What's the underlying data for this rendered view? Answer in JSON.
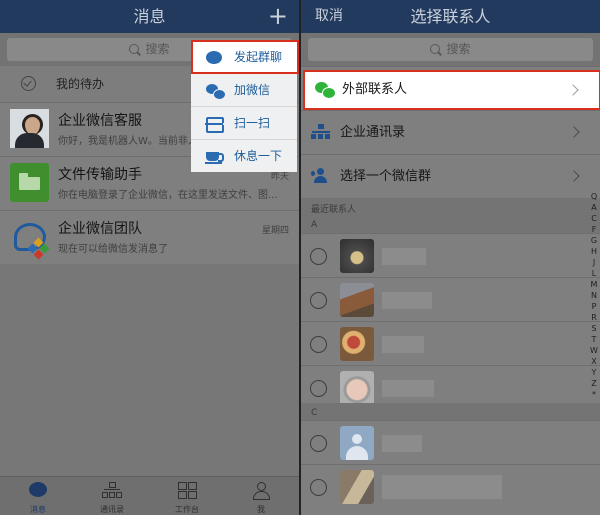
{
  "left": {
    "title": "消息",
    "plus_label": "+",
    "search_placeholder": "搜索",
    "todo_label": "我的待办",
    "conversations": [
      {
        "name": "企业微信客服",
        "msg": "你好，我是机器人W。当前非人",
        "time": ""
      },
      {
        "name": "文件传输助手",
        "msg": "你在电脑登录了企业微信，在这里发送文件、图...",
        "time": "昨天"
      },
      {
        "name": "企业微信团队",
        "msg": "现在可以给微信发消息了",
        "time": "星期四"
      }
    ],
    "popup": [
      {
        "label": "发起群聊",
        "icon": "chat-bubble-icon"
      },
      {
        "label": "加微信",
        "icon": "wechat-icon"
      },
      {
        "label": "扫一扫",
        "icon": "scan-icon"
      },
      {
        "label": "休息一下",
        "icon": "coffee-cup-icon"
      }
    ],
    "tabs": [
      {
        "label": "消息",
        "icon": "message-icon"
      },
      {
        "label": "通讯录",
        "icon": "org-chart-icon"
      },
      {
        "label": "工作台",
        "icon": "grid-icon"
      },
      {
        "label": "我",
        "icon": "person-icon"
      }
    ]
  },
  "right": {
    "cancel_label": "取消",
    "title": "选择联系人",
    "search_placeholder": "搜索",
    "options": [
      {
        "label": "外部联系人",
        "icon": "wechat-icon"
      },
      {
        "label": "企业通讯录",
        "icon": "org-chart-icon"
      },
      {
        "label": "选择一个微信群",
        "icon": "group-icon"
      }
    ],
    "recent_label": "最近联系人",
    "section_a": "A",
    "section_c": "C",
    "index_letters": [
      "Q",
      "A",
      "C",
      "F",
      "G",
      "H",
      "J",
      "L",
      "M",
      "N",
      "P",
      "R",
      "S",
      "T",
      "W",
      "X",
      "Y",
      "Z",
      "*"
    ]
  },
  "colors": {
    "accent": "#1f5d9a",
    "highlight": "#d9301e",
    "topbar": "#233a5f",
    "wechat_green": "#2fb43a"
  }
}
